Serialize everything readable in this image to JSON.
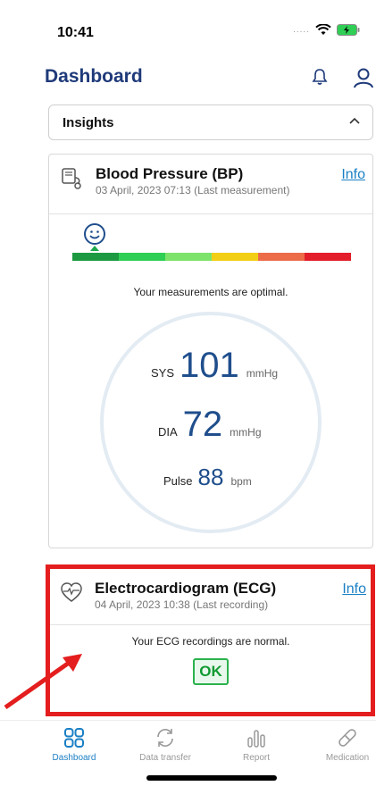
{
  "status_bar": {
    "time": "10:41",
    "signal": "....."
  },
  "header": {
    "title": "Dashboard"
  },
  "insights": {
    "label": "Insights"
  },
  "bp_card": {
    "title": "Blood Pressure (BP)",
    "subtitle": "03 April, 2023 07:13 (Last measurement)",
    "info": "Info",
    "message": "Your measurements are optimal.",
    "scale_colors": [
      "#1d9a41",
      "#2fcf55",
      "#7de36a",
      "#f2cf15",
      "#ec6c4a",
      "#e31d2a"
    ],
    "scale_level_index": 0,
    "sys": {
      "label": "SYS",
      "value": "101",
      "unit": "mmHg"
    },
    "dia": {
      "label": "DIA",
      "value": "72",
      "unit": "mmHg"
    },
    "pulse": {
      "label": "Pulse",
      "value": "88",
      "unit": "bpm"
    }
  },
  "ecg_card": {
    "title": "Electrocardiogram (ECG)",
    "subtitle": "04 April, 2023 10:38 (Last recording)",
    "info": "Info",
    "message": "Your ECG recordings are normal.",
    "badge": "OK"
  },
  "nav": {
    "items": [
      {
        "label": "Dashboard",
        "icon": "dashboard-icon",
        "active": true
      },
      {
        "label": "Data transfer",
        "icon": "sync-icon",
        "active": false
      },
      {
        "label": "Report",
        "icon": "report-icon",
        "active": false
      },
      {
        "label": "Medication",
        "icon": "pill-icon",
        "active": false
      }
    ]
  },
  "colors": {
    "accent": "#1a7fc4",
    "title": "#1f3a7a",
    "value": "#1f4e8c",
    "highlight": "#e41e1e",
    "ok": "#2bb24c"
  }
}
